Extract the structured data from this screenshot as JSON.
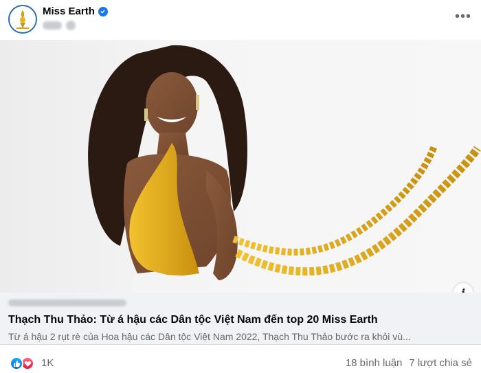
{
  "post": {
    "page_name": "Miss Earth",
    "more_label": "•••"
  },
  "link_preview": {
    "title": "Thạch Thu Thảo: Từ á hậu các Dân tộc Việt Nam đến top 20 Miss Earth",
    "description": "Từ á hậu 2 rụt rè của Hoa hậu các Dân tộc Việt Nam 2022, Thạch Thu Thảo bước ra khỏi vù..."
  },
  "info_label": "i",
  "reactions": {
    "icons": [
      "like-icon",
      "love-icon"
    ],
    "count": "1K",
    "comments": "18 bình luận",
    "shares": "7 lượt chia sẻ"
  },
  "colors": {
    "accent": "#1877f2",
    "avatar_ring": "#2f6fb1",
    "gold": "#e6b417",
    "preview_bg": "#f0f2f5"
  }
}
